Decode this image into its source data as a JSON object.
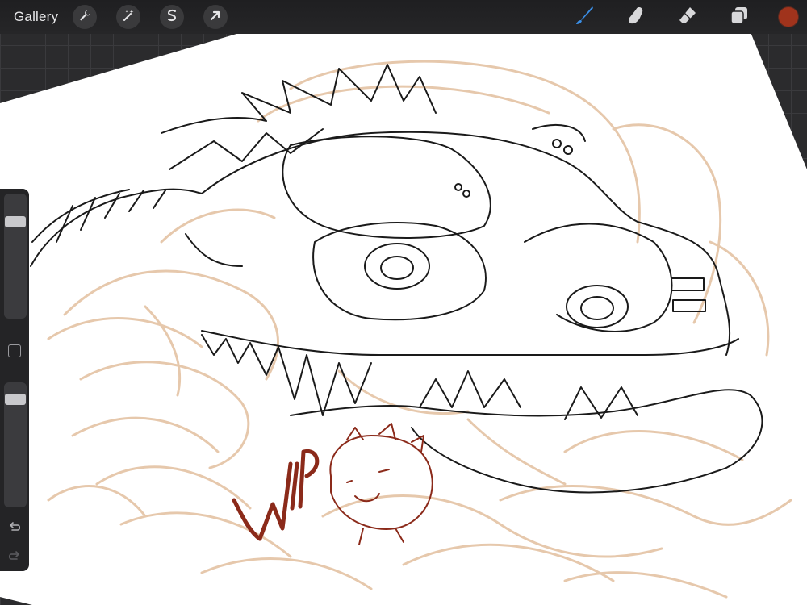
{
  "toolbar": {
    "gallery_label": "Gallery",
    "left_tools": [
      {
        "name": "actions",
        "icon": "wrench-icon"
      },
      {
        "name": "adjustments",
        "icon": "magic-wand-icon"
      },
      {
        "name": "selection",
        "icon": "selection-s-icon"
      },
      {
        "name": "transform",
        "icon": "arrow-cursor-icon"
      }
    ],
    "right_tools": [
      {
        "name": "brush",
        "icon": "brush-icon",
        "active": true
      },
      {
        "name": "smudge",
        "icon": "smudge-finger-icon"
      },
      {
        "name": "eraser",
        "icon": "eraser-icon"
      },
      {
        "name": "layers",
        "icon": "layers-icon"
      }
    ],
    "current_color": "#a0331c",
    "active_tool_color": "#3a8ee6"
  },
  "sidebar": {
    "brush_size_level": 0.2,
    "opacity_level": 0.1,
    "controls": [
      "size-slider",
      "modify-button",
      "opacity-slider",
      "undo",
      "redo"
    ]
  },
  "canvas": {
    "handwritten_text": "WIP",
    "sketch_color": "#e4c3a4",
    "ink_color": "#1a1a1a",
    "annotation_color": "#8b2a1a",
    "paper_color": "#ffffff"
  }
}
